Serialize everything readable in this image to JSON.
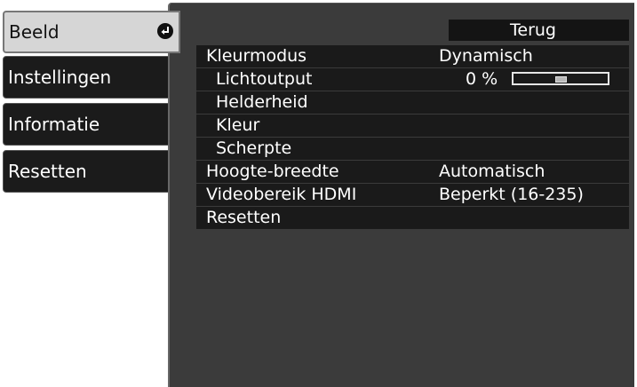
{
  "sidebar": {
    "tabs": [
      {
        "label": "Beeld",
        "active": true
      },
      {
        "label": "Instellingen",
        "active": false
      },
      {
        "label": "Informatie",
        "active": false
      },
      {
        "label": "Resetten",
        "active": false
      }
    ],
    "active_icon": "enter-icon"
  },
  "header": {
    "back_label": "Terug"
  },
  "menu": {
    "items": [
      {
        "label": "Kleurmodus",
        "value": "Dynamisch"
      },
      {
        "label": "Lichtoutput",
        "value": "0 %",
        "slider_level": 0.5
      },
      {
        "label": "Helderheid",
        "value": ""
      },
      {
        "label": "Kleur",
        "value": ""
      },
      {
        "label": "Scherpte",
        "value": ""
      },
      {
        "label": "Hoogte-breedte",
        "value": "Automatisch"
      },
      {
        "label": "Videobereik HDMI",
        "value": "Beperkt (16-235)"
      },
      {
        "label": "Resetten",
        "value": ""
      }
    ]
  },
  "colors": {
    "panel_bg": "#3b3b3b",
    "row_bg": "#1a1a1a",
    "active_tab_bg": "#d6d6d6",
    "tab_bg": "#1b1b1b",
    "text": "#ffffff"
  }
}
